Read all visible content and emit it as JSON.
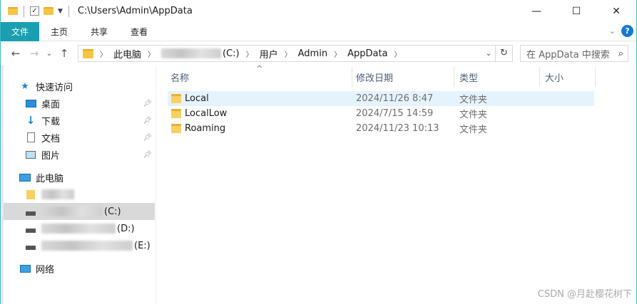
{
  "titlebar": {
    "path": "C:\\Users\\Admin\\AppData",
    "minimize_glyph": "—",
    "maximize_glyph": "☐",
    "close_glyph": "✕"
  },
  "ribbon": {
    "tabs": [
      "文件",
      "主页",
      "共享",
      "查看"
    ],
    "help": "?"
  },
  "address": {
    "crumbs": [
      "此电脑",
      "(C:)",
      "用户",
      "Admin",
      "AppData"
    ],
    "search_placeholder": "在 AppData 中搜索"
  },
  "sidebar": {
    "quick_access": "快速访问",
    "items": [
      "桌面",
      "下载",
      "文档",
      "图片"
    ],
    "this_pc": "此电脑",
    "drives": [
      "(C:)",
      "(D:)",
      "(E:)"
    ],
    "network": "网络"
  },
  "columns": {
    "name": "名称",
    "modified": "修改日期",
    "type": "类型",
    "size": "大小"
  },
  "files": [
    {
      "name": "Local",
      "modified": "2024/11/26 8:47",
      "type": "文件夹"
    },
    {
      "name": "LocalLow",
      "modified": "2024/7/15 14:59",
      "type": "文件夹"
    },
    {
      "name": "Roaming",
      "modified": "2024/11/23 10:13",
      "type": "文件夹"
    }
  ],
  "watermark": "CSDN @月赴樱花树下",
  "icons": [
    "folder-icon",
    "checkbox-icon",
    "pin-icon",
    "star-icon",
    "desktop-icon",
    "download-icon",
    "document-icon",
    "picture-icon",
    "computer-icon",
    "drive-icon",
    "network-icon",
    "search-icon",
    "refresh-icon",
    "help-icon"
  ]
}
